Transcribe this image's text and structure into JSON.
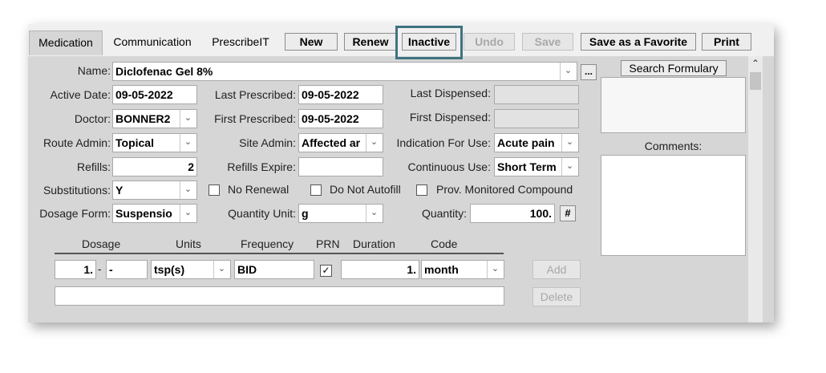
{
  "tabs": [
    "Medication",
    "Communication",
    "PrescribeIT"
  ],
  "toolbar": {
    "new": "New",
    "renew": "Renew",
    "inactive": "Inactive",
    "undo": "Undo",
    "save": "Save",
    "favorite": "Save as a Favorite",
    "print": "Print"
  },
  "highlight_color": "#3e7380",
  "form": {
    "name_label": "Name:",
    "name_value": "Diclofenac Gel 8%",
    "more": "...",
    "active_date_label": "Active Date:",
    "active_date": "09-05-2022",
    "last_prescribed_label": "Last Prescribed:",
    "last_prescribed": "09-05-2022",
    "last_dispensed_label": "Last Dispensed:",
    "doctor_label": "Doctor:",
    "doctor": "BONNER2",
    "first_prescribed_label": "First Prescribed:",
    "first_prescribed": "09-05-2022",
    "first_dispensed_label": "First Dispensed:",
    "route_label": "Route Admin:",
    "route": "Topical",
    "site_label": "Site Admin:",
    "site": "Affected ar",
    "indication_label": "Indication For Use:",
    "indication": "Acute pain",
    "refills_label": "Refills:",
    "refills": "2",
    "refills_expire_label": "Refills Expire:",
    "continuous_label": "Continuous Use:",
    "continuous": "Short Term",
    "subs_label": "Substitutions:",
    "subs": "Y",
    "no_renewal": "No Renewal",
    "no_autofill": "Do Not Autofill",
    "prov_monitored": "Prov. Monitored Compound",
    "dosage_form_label": "Dosage Form:",
    "dosage_form": "Suspensio",
    "qty_unit_label": "Quantity Unit:",
    "qty_unit": "g",
    "quantity_label": "Quantity:",
    "quantity": "100.",
    "hash": "#"
  },
  "dosing": {
    "headers": {
      "dosage": "Dosage",
      "units": "Units",
      "frequency": "Frequency",
      "prn": "PRN",
      "duration": "Duration",
      "code": "Code"
    },
    "dosage": "1.",
    "dosage_sep": "-",
    "dosage2": "-",
    "units": "tsp(s)",
    "frequency": "BID",
    "duration": "1.",
    "code": "month",
    "add": "Add",
    "delete": "Delete"
  },
  "side": {
    "search": "Search Formulary",
    "comments": "Comments:"
  }
}
